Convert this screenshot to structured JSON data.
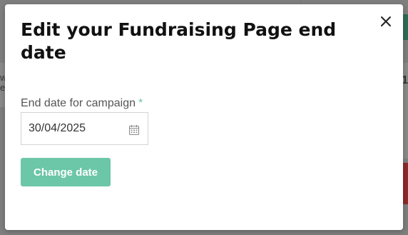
{
  "modal": {
    "title": "Edit your Fundraising Page end date",
    "close_icon": "close-icon"
  },
  "form": {
    "label": "End date for campaign",
    "required_mark": "*",
    "end_date_value": "30/04/2025",
    "calendar_icon": "calendar-icon",
    "submit_label": "Change date"
  },
  "background": {
    "left_text": "w\ne",
    "right_number": "1"
  },
  "colors": {
    "accent": "#6cc6a8",
    "overlay": "#7f7f7f",
    "title_text": "#111111",
    "label_text": "#555555"
  }
}
